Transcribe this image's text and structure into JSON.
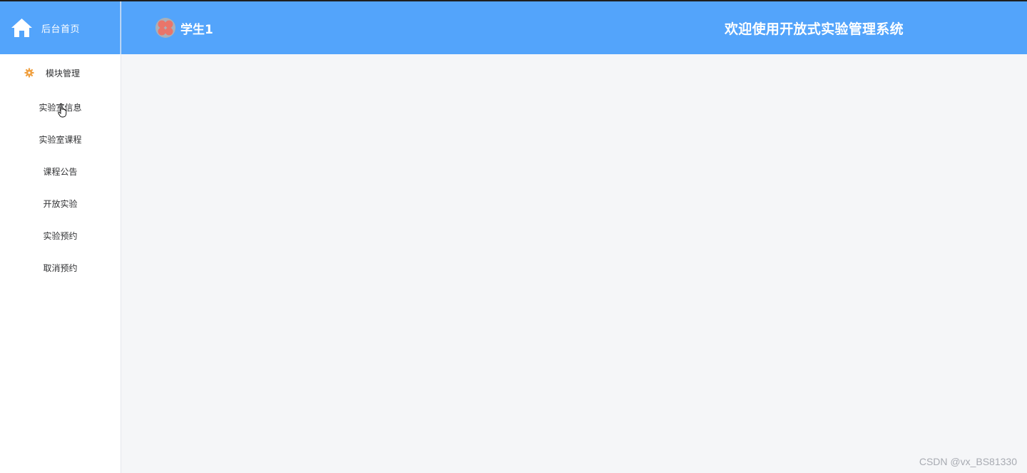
{
  "sidebar": {
    "home_label": "后台首页",
    "group_label": "模块管理",
    "items": [
      {
        "label": "实验室信息"
      },
      {
        "label": "实验室课程"
      },
      {
        "label": "课程公告"
      },
      {
        "label": "开放实验"
      },
      {
        "label": "实验预约"
      },
      {
        "label": "取消预约"
      }
    ]
  },
  "header": {
    "user_name": "学生1",
    "system_title": "欢迎使用开放式实验管理系统"
  },
  "watermark": "CSDN @vx_BS81330",
  "colors": {
    "header_bg": "#53a4fb",
    "sidebar_bg": "#ffffff",
    "main_bg": "#f5f6f8",
    "gear_icon": "#f0a040"
  }
}
